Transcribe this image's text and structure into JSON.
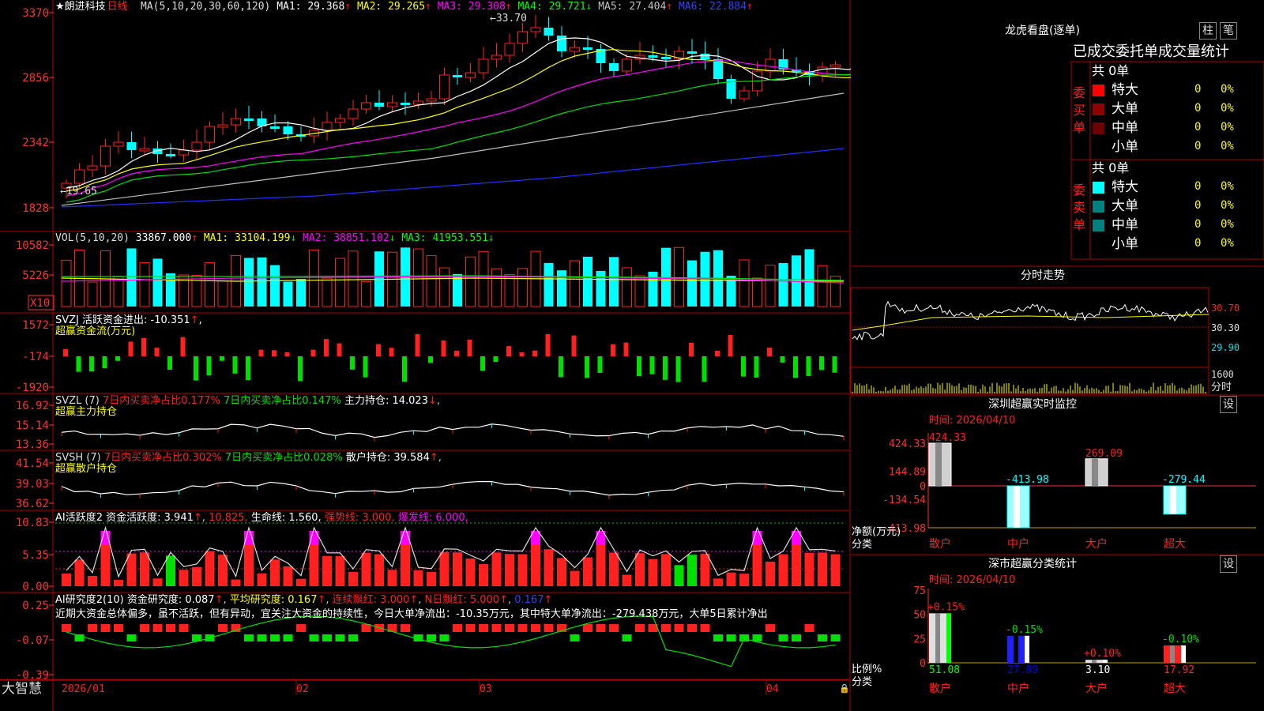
{
  "brand": "大智慧",
  "stock": {
    "star": "★",
    "name": "朗进科技",
    "period": "日线"
  },
  "colors": {
    "up": "#ff2020",
    "down": "#00ffff",
    "green": "#00e000",
    "yellow": "#ffff00",
    "magenta": "#ff00ff",
    "white": "#ffffff",
    "blue": "#2030ff",
    "gray": "#c0c0c0",
    "axis": "#ff3030",
    "grid": "#b00000",
    "darkred": "#900000",
    "teal": "#008080"
  },
  "kline": {
    "ma_label": "MA(5,10,20,30,60,120)",
    "ma": [
      {
        "label": "MA1: 29.368",
        "arrow": "↑",
        "color": "#ffffff"
      },
      {
        "label": "MA2: 29.265",
        "arrow": "↑",
        "color": "#ffff00"
      },
      {
        "label": "MA3: 29.308",
        "arrow": "↑",
        "color": "#ff00ff"
      },
      {
        "label": "MA4: 29.721",
        "arrow": "↓",
        "color": "#00ff00"
      },
      {
        "label": "MA5: 27.404",
        "arrow": "↑",
        "color": "#c0c0c0"
      },
      {
        "label": "MA6: 22.884",
        "arrow": "↑",
        "color": "#3040ff"
      }
    ],
    "y_ticks": [
      "3370",
      "2856",
      "2342",
      "1828"
    ],
    "high_label": "33.70",
    "low_label": "19.65"
  },
  "vol": {
    "label": "VOL(5,10,20)",
    "value": "33867.000",
    "arrow": "↑",
    "ma": [
      {
        "label": "MA1: 33104.199",
        "arrow": "↓",
        "color": "#ffff00"
      },
      {
        "label": "MA2: 38851.102",
        "arrow": "↓",
        "color": "#ff00ff"
      },
      {
        "label": "MA3: 41953.551",
        "arrow": "↓",
        "color": "#00ff00"
      }
    ],
    "y_ticks": [
      "10582",
      "5226"
    ],
    "unit": "X10"
  },
  "svzj": {
    "title": "SVZJ  活跃资金进出: -10.351",
    "arrow": "↑",
    "sub": "超赢资金流(万元)",
    "y_ticks": [
      "1572",
      "-174",
      "-1920"
    ]
  },
  "svzl": {
    "name": "SVZL (7)",
    "a": "7日内买卖净占比0.177%",
    "b": "7日内买卖净占比0.147%",
    "c": "主力持仓: 14.023",
    "arrow": "↓",
    "sub": "超赢主力持仓",
    "y_ticks": [
      "16.92",
      "15.14",
      "13.36"
    ]
  },
  "svsh": {
    "name": "SVSH (7)",
    "a": "7日内买卖净占比0.302%",
    "b": "7日内买卖净占比0.028%",
    "c": "散户持仓: 39.584",
    "arrow": "↑",
    "sub": "超赢散户持仓",
    "y_ticks": [
      "41.54",
      "39.03",
      "36.62"
    ]
  },
  "ai_act": {
    "name": "AI活跃度2",
    "a": "资金活跃度: 3.941",
    "b": "10.825,",
    "c": "生命线: 1.560,",
    "d": "强势线: 3.000,",
    "e": "爆发线: 6.000,",
    "y_ticks": [
      "10.83",
      "5.35",
      "0.00"
    ]
  },
  "ai_res": {
    "name": "AI研究度2(10)",
    "a": "资金研究度: 0.087",
    "b": "平均研究度: 0.167",
    "c": "连续飘红: 3.000",
    "d": "N日飘红: 5.000",
    "e": "0.167",
    "text": "近期大资金总体偏多，虽不活跃，但有异动，宜关注大资金的持续性，今日大单净流出：-10.35万元，其中特大单净流出：-279.438万元，大单5日累计净出",
    "y_ticks": [
      "0.25",
      "-0.07",
      "-0.39"
    ]
  },
  "dates": [
    "2026/01",
    "02",
    "03",
    "04"
  ],
  "dragon": {
    "title": "龙虎看盘(逐单)",
    "tabs": [
      "柱",
      "笔"
    ],
    "header": "已成交委托单成交量统计",
    "buy": {
      "side": [
        "委",
        "买",
        "单"
      ],
      "total": "共 0单",
      "rows": [
        {
          "name": "特大",
          "v": "0",
          "p": "0%",
          "color": "#ff0000"
        },
        {
          "name": "大单",
          "v": "0",
          "p": "0%",
          "color": "#900000"
        },
        {
          "name": "中单",
          "v": "0",
          "p": "0%",
          "color": "#700000"
        },
        {
          "name": "小单",
          "v": "0",
          "p": "0%",
          "color": ""
        }
      ]
    },
    "sell": {
      "side": [
        "委",
        "卖",
        "单"
      ],
      "total": "共 0单",
      "rows": [
        {
          "name": "特大",
          "v": "0",
          "p": "0%",
          "color": "#00ffff"
        },
        {
          "name": "大单",
          "v": "0",
          "p": "0%",
          "color": "#008080"
        },
        {
          "name": "中单",
          "v": "0",
          "p": "0%",
          "color": "#008080"
        },
        {
          "name": "小单",
          "v": "0",
          "p": "0%",
          "color": ""
        }
      ]
    }
  },
  "intraday": {
    "title": "分时走势",
    "prices": [
      "30.70",
      "30.30",
      "29.90"
    ],
    "vol": "1600",
    "vol_label": "分时"
  },
  "sz_monitor": {
    "title": "深圳超赢实时监控",
    "settings": "设",
    "time": "时间: 2026/04/10",
    "y_ticks": [
      "424.33",
      "144.89",
      "0",
      "-134.54",
      "-413.98"
    ],
    "unit": "净额(万元)",
    "cat_label": "分类",
    "chart_data": {
      "type": "bar",
      "categories": [
        "散户",
        "中户",
        "大户",
        "超大"
      ],
      "values": [
        424.33,
        -413.98,
        269.09,
        -279.44
      ],
      "labels": [
        "424.33",
        "-413.98",
        "269.09",
        "-279.44"
      ],
      "ylim": [
        -413.98,
        424.33
      ]
    }
  },
  "sz_class": {
    "title": "深市超赢分类统计",
    "settings": "设",
    "time": "时间: 2026/04/10",
    "y_ticks": [
      "75",
      "50",
      "25",
      "0"
    ],
    "unit": "比例%",
    "cat_label": "分类",
    "chart_data": {
      "type": "bar",
      "categories": [
        "散户",
        "中户",
        "大户",
        "超大"
      ],
      "values": [
        51.08,
        27.89,
        3.1,
        17.92
      ],
      "changes": [
        "+0.15%",
        "-0.15%",
        "+0.10%",
        "-0.10%"
      ],
      "ylim": [
        0,
        75
      ]
    }
  }
}
